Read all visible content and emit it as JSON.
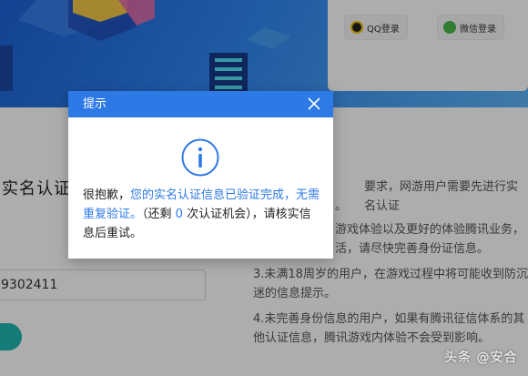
{
  "login": {
    "qq_label": "QQ登录",
    "wechat_label": "微信登录"
  },
  "left": {
    "title": "实名认证",
    "id_value": "9302411"
  },
  "notices": {
    "line1": "要求，网游用户需要先进行实名认证",
    "line1b": "。",
    "line2": "游戏体验以及更好的体验腾讯业务，",
    "line2b": "活，请尽快完善身份证信息。",
    "line3a": "3.未满18周岁的用户，在游戏过程中将可能收到防沉",
    "line3b": "迷的信息提示。",
    "line4a": "4.未完善身份信息的用户，如果有腾讯征信体系的其",
    "line4b": "他认证信息，腾讯游戏内体验不会受到影响。"
  },
  "dialog": {
    "title": "提示",
    "msg_prefix": "很抱歉，",
    "msg_highlight": "您的实名认证信息已验证完成，无需重复验证。",
    "msg_mid1": "（还剩 ",
    "msg_count": "0",
    "msg_mid2": " 次认证机会），请核实信息后重试。"
  },
  "watermark": "头条 @安合",
  "colors": {
    "dialog_header": "#2d79e6",
    "highlight": "#2d79e6",
    "submit": "#1fb6b0"
  },
  "icons": [
    "info-icon",
    "close-icon",
    "qq-icon",
    "wechat-icon"
  ]
}
